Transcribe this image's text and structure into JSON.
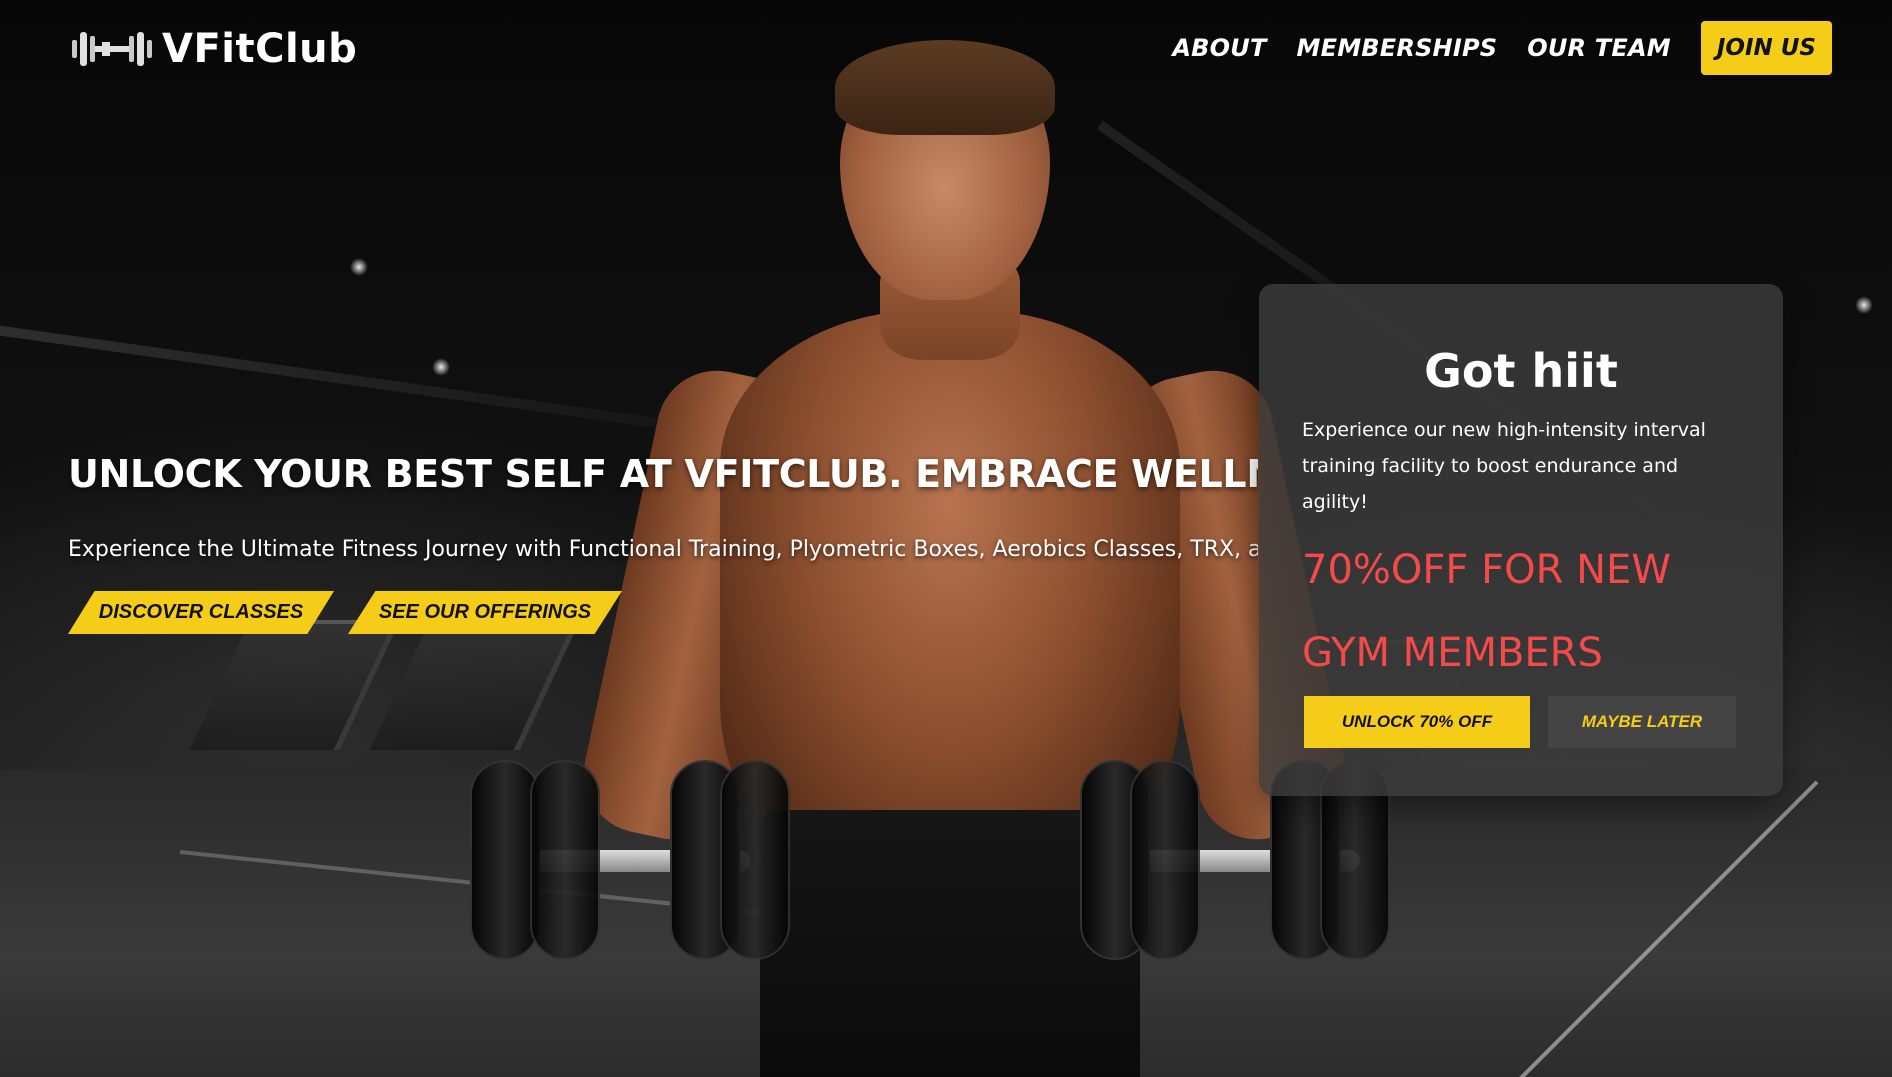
{
  "brand": {
    "name": "VFitClub",
    "logo_icon": "barbell-icon"
  },
  "nav": {
    "links": [
      "ABOUT",
      "MEMBERSHIPS",
      "OUR TEAM"
    ],
    "cta": "JOIN US"
  },
  "hero": {
    "headline": "UNLOCK YOUR BEST SELF AT VFITCLUB. EMBRACE WELLNESS, TRANSF",
    "subline": "Experience the Ultimate Fitness Journey with Functional Training, Plyometric Boxes, Aerobics Classes, TRX, a",
    "buttons": [
      "DISCOVER CLASSES",
      "SEE OUR OFFERINGS"
    ]
  },
  "promo": {
    "title": "Got hiit",
    "description": "Experience our new high-intensity interval training facility to boost endurance and agility!",
    "offer": "70%OFF FOR NEW GYM MEMBERS",
    "primary_button": "UNLOCK 70% OFF",
    "secondary_button": "MAYBE LATER"
  },
  "colors": {
    "accent": "#f5cc17",
    "offer_red": "#f44a4a",
    "card_bg": "#3c3c3c"
  }
}
